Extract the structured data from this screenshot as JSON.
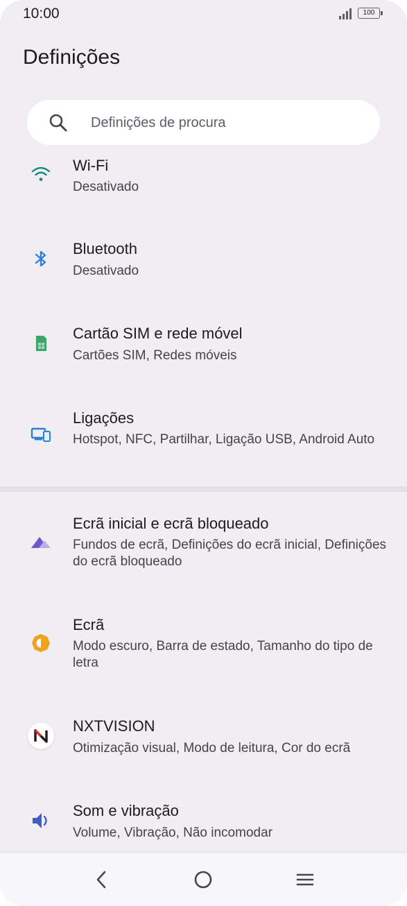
{
  "status_bar": {
    "time": "10:00",
    "battery": "100",
    "signal-icon": "signal-icon",
    "battery-icon": "battery-icon"
  },
  "page_title": "Definições",
  "search": {
    "placeholder": "Definições de procura",
    "icon": "search-icon"
  },
  "items": [
    {
      "title": "Wi-Fi",
      "subtitle": "Desativado",
      "icon": "wifi-icon",
      "color": "#0f8a78"
    },
    {
      "title": "Bluetooth",
      "subtitle": "Desativado",
      "icon": "bluetooth-icon",
      "color": "#2f80d6"
    },
    {
      "title": "Cartão SIM e rede móvel",
      "subtitle": "Cartões SIM, Redes móveis",
      "icon": "sim-card-icon",
      "color": "#3ba56a"
    },
    {
      "title": "Ligações",
      "subtitle": "Hotspot, NFC, Partilhar, Ligação USB, Android Auto",
      "icon": "devices-icon",
      "color": "#2d7fd6"
    },
    {
      "title": "Ecrã inicial e ecrã bloqueado",
      "subtitle": "Fundos de ecrã, Definições do ecrã inicial, Definições do ecrã bloqueado",
      "icon": "wallpaper-icon",
      "color": "#6f57c9"
    },
    {
      "title": "Ecrã",
      "subtitle": "Modo escuro, Barra de estado, Tamanho do tipo de letra",
      "icon": "brightness-icon",
      "color": "#f2a11a"
    },
    {
      "title": "NXTVISION",
      "subtitle": "Otimização visual, Modo de leitura, Cor do ecrã",
      "icon": "nxtvision-icon",
      "color": "#d8322d"
    },
    {
      "title": "Som e vibração",
      "subtitle": "Volume, Vibração, Não incomodar",
      "icon": "speaker-icon",
      "color": "#3f5fc4"
    }
  ],
  "navigation": {
    "back": "back-icon",
    "home": "home-icon",
    "recents": "menu-icon"
  }
}
